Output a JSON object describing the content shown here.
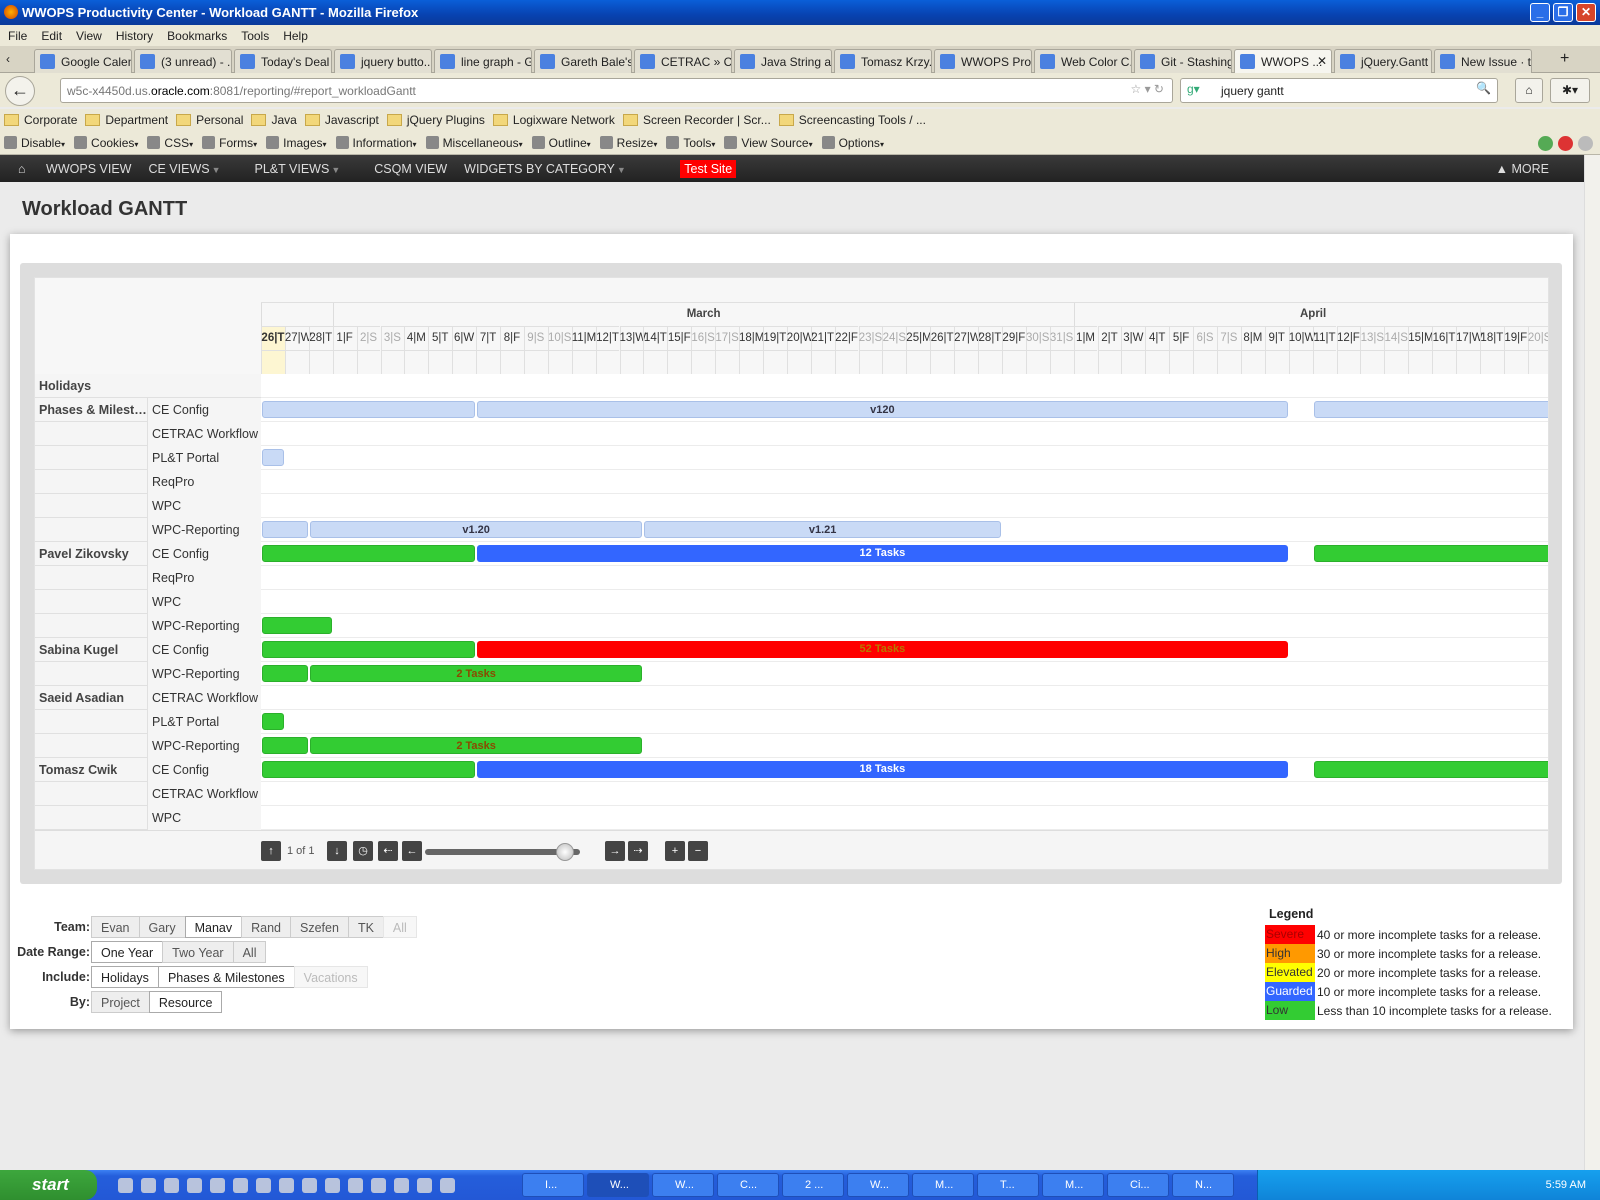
{
  "window": {
    "title": "WWOPS Productivity Center - Workload GANTT - Mozilla Firefox"
  },
  "menu": [
    "File",
    "Edit",
    "View",
    "History",
    "Bookmarks",
    "Tools",
    "Help"
  ],
  "tabs": [
    {
      "label": "Google Calen..."
    },
    {
      "label": "(3 unread) - ..."
    },
    {
      "label": "Today's Deal"
    },
    {
      "label": "jquery butto..."
    },
    {
      "label": "line graph - G..."
    },
    {
      "label": "Gareth Bale's..."
    },
    {
      "label": "CETRAC » C..."
    },
    {
      "label": "Java String a..."
    },
    {
      "label": "Tomasz Krzy..."
    },
    {
      "label": "WWOPS Pro..."
    },
    {
      "label": "Web Color C..."
    },
    {
      "label": "Git - Stashing"
    },
    {
      "label": "WWOPS ...",
      "active": true
    },
    {
      "label": "jQuery.Gantt"
    },
    {
      "label": "New Issue · t..."
    }
  ],
  "url": {
    "pre": "w5c-x4450d.us.",
    "host": "oracle.com",
    "post": ":8081/reporting/#report_workloadGantt"
  },
  "search": {
    "value": "jquery gantt"
  },
  "bookmarks": [
    "Corporate",
    "Department",
    "Personal",
    "Java",
    "Javascript",
    "jQuery Plugins",
    "Logixware Network",
    "Screen Recorder | Scr...",
    "Screencasting Tools / ..."
  ],
  "devtools": [
    "Disable",
    "Cookies",
    "CSS",
    "Forms",
    "Images",
    "Information",
    "Miscellaneous",
    "Outline",
    "Resize",
    "Tools",
    "View Source",
    "Options"
  ],
  "sitenav": {
    "items": [
      {
        "label": "WWOPS VIEW"
      },
      {
        "label": "CE VIEWS",
        "dropdown": true
      },
      {
        "label": "PL&T VIEWS",
        "dropdown": true
      },
      {
        "label": "CSQM VIEW"
      },
      {
        "label": "WIDGETS BY CATEGORY",
        "dropdown": true
      }
    ],
    "test_site": "Test Site",
    "more": "MORE"
  },
  "page": {
    "title": "Workload GANTT"
  },
  "gantt": {
    "months": [
      {
        "name": "",
        "days": 3
      },
      {
        "name": "March",
        "days": 31
      },
      {
        "name": "April",
        "days": 20
      }
    ],
    "days": [
      "26|T",
      "27|W",
      "28|T",
      "1|F",
      "2|S",
      "3|S",
      "4|M",
      "5|T",
      "6|W",
      "7|T",
      "8|F",
      "9|S",
      "10|S",
      "11|M",
      "12|T",
      "13|W",
      "14|T",
      "15|F",
      "16|S",
      "17|S",
      "18|M",
      "19|T",
      "20|W",
      "21|T",
      "22|F",
      "23|S",
      "24|S",
      "25|M",
      "26|T",
      "27|W",
      "28|T",
      "29|F",
      "30|S",
      "31|S",
      "1|M",
      "2|T",
      "3|W",
      "4|T",
      "5|F",
      "6|S",
      "7|S",
      "8|M",
      "9|T",
      "10|W",
      "11|T",
      "12|F",
      "13|S",
      "14|S",
      "15|M",
      "16|T",
      "17|W",
      "18|T",
      "19|F",
      "20|S"
    ],
    "today": "Feb 26",
    "rows": [
      {
        "group": "Holidays",
        "project": ""
      },
      {
        "group": "Phases & Milestones",
        "project": "CE Config",
        "bars": [
          {
            "from": "Feb 26",
            "to": "Mar 6",
            "type": "phase"
          },
          {
            "from": "Mar 7",
            "to": "Apr 9",
            "type": "phase",
            "label": "v120"
          },
          {
            "from": "Apr 11",
            "to": "Apr 20",
            "type": "phase"
          }
        ]
      },
      {
        "group": "",
        "project": "CETRAC Workflow"
      },
      {
        "group": "",
        "project": "PL&T Portal",
        "bars": [
          {
            "from": "Feb 26",
            "to": "Feb 26",
            "type": "phase"
          }
        ]
      },
      {
        "group": "",
        "project": "ReqPro"
      },
      {
        "group": "",
        "project": "WPC"
      },
      {
        "group": "",
        "project": "WPC-Reporting",
        "bars": [
          {
            "from": "Feb 26",
            "to": "Feb 27",
            "type": "phase"
          },
          {
            "from": "Feb 28",
            "to": "Mar 13",
            "type": "phase",
            "label": "v1.20"
          },
          {
            "from": "Mar 14",
            "to": "Mar 28",
            "type": "phase",
            "label": "v1.21"
          }
        ]
      },
      {
        "group": "Pavel Zikovsky",
        "project": "CE Config",
        "bars": [
          {
            "from": "Feb 26",
            "to": "Mar 6",
            "type": "low"
          },
          {
            "from": "Mar 7",
            "to": "Apr 9",
            "type": "guarded",
            "label": "12 Tasks"
          },
          {
            "from": "Apr 11",
            "to": "Apr 20",
            "type": "low"
          }
        ]
      },
      {
        "group": "",
        "project": "ReqPro"
      },
      {
        "group": "",
        "project": "WPC"
      },
      {
        "group": "",
        "project": "WPC-Reporting",
        "bars": [
          {
            "from": "Feb 26",
            "to": "Feb 28",
            "type": "low"
          }
        ]
      },
      {
        "group": "Sabina Kugel",
        "project": "CE Config",
        "bars": [
          {
            "from": "Feb 26",
            "to": "Mar 6",
            "type": "low"
          },
          {
            "from": "Mar 7",
            "to": "Apr 9",
            "type": "severe",
            "label": "52 Tasks"
          }
        ]
      },
      {
        "group": "",
        "project": "WPC-Reporting",
        "bars": [
          {
            "from": "Feb 26",
            "to": "Feb 27",
            "type": "low"
          },
          {
            "from": "Feb 28",
            "to": "Mar 13",
            "type": "low",
            "label": "2 Tasks"
          }
        ]
      },
      {
        "group": "Saeid Asadian",
        "project": "CETRAC Workflow"
      },
      {
        "group": "",
        "project": "PL&T Portal",
        "bars": [
          {
            "from": "Feb 26",
            "to": "Feb 26",
            "type": "low"
          }
        ]
      },
      {
        "group": "",
        "project": "WPC-Reporting",
        "bars": [
          {
            "from": "Feb 26",
            "to": "Feb 27",
            "type": "low"
          },
          {
            "from": "Feb 28",
            "to": "Mar 13",
            "type": "low",
            "label": "2 Tasks"
          }
        ]
      },
      {
        "group": "Tomasz Cwik",
        "project": "CE Config",
        "bars": [
          {
            "from": "Feb 26",
            "to": "Mar 6",
            "type": "low"
          },
          {
            "from": "Mar 7",
            "to": "Apr 9",
            "type": "guarded",
            "label": "18 Tasks"
          },
          {
            "from": "Apr 11",
            "to": "Apr 20",
            "type": "low"
          }
        ]
      },
      {
        "group": "",
        "project": "CETRAC Workflow"
      },
      {
        "group": "",
        "project": "WPC"
      }
    ],
    "pager": "1 of 1",
    "zoom_level": 0.9
  },
  "filters": [
    {
      "label": "Team:",
      "options": [
        {
          "t": "Evan"
        },
        {
          "t": "Gary"
        },
        {
          "t": "Manav",
          "on": true
        },
        {
          "t": "Rand"
        },
        {
          "t": "Szefen"
        },
        {
          "t": "TK"
        },
        {
          "t": "All",
          "dis": true
        }
      ]
    },
    {
      "label": "Date Range:",
      "options": [
        {
          "t": "One Year",
          "on": true
        },
        {
          "t": "Two Year"
        },
        {
          "t": "All"
        }
      ]
    },
    {
      "label": "Include:",
      "options": [
        {
          "t": "Holidays",
          "on": true
        },
        {
          "t": "Phases & Milestones",
          "on": true
        },
        {
          "t": "Vacations",
          "dis": true
        }
      ]
    },
    {
      "label": "By:",
      "options": [
        {
          "t": "Project"
        },
        {
          "t": "Resource",
          "on": true
        }
      ]
    }
  ],
  "legend": {
    "title": "Legend",
    "items": [
      {
        "name": "Severe",
        "color": "#ff0000",
        "text": "40 or more incomplete tasks for a release."
      },
      {
        "name": "High",
        "color": "#ff9900",
        "text": "30 or more incomplete tasks for a release."
      },
      {
        "name": "Elevated",
        "color": "#ffff00",
        "text": "20 or more incomplete tasks for a release."
      },
      {
        "name": "Guarded",
        "color": "#3366ff",
        "text": "10 or more incomplete tasks for a release."
      },
      {
        "name": "Low",
        "color": "#33cc33",
        "text": "Less than 10 incomplete tasks for a release."
      }
    ]
  },
  "taskbar": {
    "start": "start",
    "items": [
      "I...",
      "W...",
      "W...",
      "C...",
      "2 ...",
      "W...",
      "M...",
      "T...",
      "M...",
      "Ci...",
      "N..."
    ],
    "active": 1,
    "clock": "5:59 AM"
  }
}
